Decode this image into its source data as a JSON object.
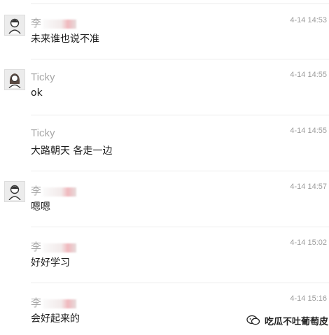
{
  "messages": [
    {
      "sender": "李",
      "time": "4-14 14:53",
      "text": "未来谁也说不准",
      "avatar": "male-avatar"
    },
    {
      "sender": "Ticky",
      "time": "4-14 14:55",
      "text": "ok",
      "avatar": "female-avatar"
    },
    {
      "sender": "Ticky",
      "time": "4-14 14:55",
      "text": "大路朝天 各走一边",
      "avatar": ""
    },
    {
      "sender": "李",
      "time": "4-14 14:57",
      "text": "嗯嗯",
      "avatar": "male-avatar"
    },
    {
      "sender": "李",
      "time": "4-14 15:02",
      "text": "好好学习",
      "avatar": ""
    },
    {
      "sender": "李",
      "time": "4-14 15:16",
      "text": "会好起来的",
      "avatar": ""
    }
  ],
  "watermark": {
    "text": "吃瓜不吐葡萄皮",
    "icon": "wechat-channel-icon"
  }
}
